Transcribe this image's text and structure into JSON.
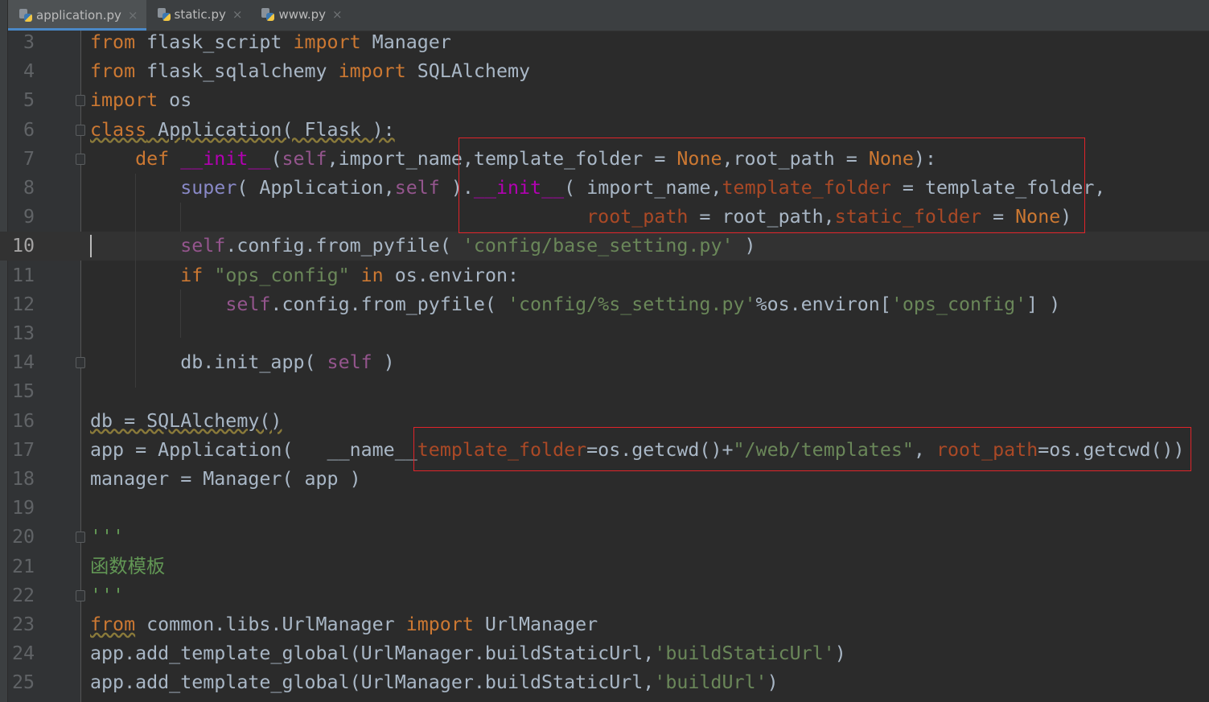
{
  "tabs": [
    {
      "label": "application.py",
      "active": true
    },
    {
      "label": "static.py"
    },
    {
      "label": "www.py"
    }
  ],
  "close_glyph": "×",
  "current_line": 10,
  "lines": [
    {
      "n": "3",
      "t": [
        [
          "from",
          "kw"
        ],
        [
          " flask_script ",
          ""
        ],
        [
          "import",
          "kw"
        ],
        [
          " Manager",
          ""
        ]
      ]
    },
    {
      "n": "4",
      "t": [
        [
          "from",
          "kw"
        ],
        [
          " flask_sqlalchemy ",
          ""
        ],
        [
          "import",
          "kw"
        ],
        [
          " SQLAlchemy",
          ""
        ]
      ]
    },
    {
      "n": "5",
      "t": [
        [
          "import",
          "kw"
        ],
        [
          " os",
          ""
        ]
      ]
    },
    {
      "n": "6",
      "t": [
        [
          "class",
          "kw wavy"
        ],
        [
          " Application( Flask ):",
          "wavy"
        ]
      ]
    },
    {
      "n": "7",
      "t": [
        [
          "    ",
          ""
        ],
        [
          "def",
          "kw"
        ],
        [
          " ",
          ""
        ],
        [
          "__init__",
          "fn"
        ],
        [
          "(",
          ""
        ],
        [
          "self",
          "self"
        ],
        [
          ",import_name,template_folder = ",
          ""
        ],
        [
          "None",
          "kw"
        ],
        [
          ",root_path = ",
          ""
        ],
        [
          "None",
          "kw"
        ],
        [
          "):",
          ""
        ]
      ]
    },
    {
      "n": "8",
      "t": [
        [
          "        ",
          ""
        ],
        [
          "super",
          "builtin"
        ],
        [
          "( Application,",
          ""
        ],
        [
          "self",
          "self"
        ],
        [
          " ).",
          ""
        ],
        [
          "__init__",
          "fn"
        ],
        [
          "( import_name,",
          ""
        ],
        [
          "template_folder",
          "param"
        ],
        [
          " = template_folder,",
          ""
        ]
      ]
    },
    {
      "n": "9",
      "t": [
        [
          "                                            ",
          ""
        ],
        [
          "root_path",
          "param"
        ],
        [
          " = root_path,",
          ""
        ],
        [
          "static_folder",
          "param"
        ],
        [
          " = ",
          ""
        ],
        [
          "None",
          "kw"
        ],
        [
          ")",
          ""
        ]
      ]
    },
    {
      "n": "10",
      "t": [
        [
          "        ",
          ""
        ],
        [
          "self",
          "self"
        ],
        [
          ".config.from_pyfile( ",
          ""
        ],
        [
          "'config/base_setting.py'",
          "str"
        ],
        [
          " )",
          ""
        ]
      ]
    },
    {
      "n": "11",
      "t": [
        [
          "        ",
          ""
        ],
        [
          "if",
          "kw"
        ],
        [
          " ",
          ""
        ],
        [
          "\"ops_config\"",
          "str"
        ],
        [
          " ",
          ""
        ],
        [
          "in",
          "kw"
        ],
        [
          " os.environ:",
          ""
        ]
      ]
    },
    {
      "n": "12",
      "t": [
        [
          "            ",
          ""
        ],
        [
          "self",
          "self"
        ],
        [
          ".config.from_pyfile( ",
          ""
        ],
        [
          "'config/%s_setting.py'",
          "str"
        ],
        [
          "%os.environ[",
          ""
        ],
        [
          "'ops_config'",
          "str"
        ],
        [
          "] )",
          ""
        ]
      ]
    },
    {
      "n": "13",
      "t": []
    },
    {
      "n": "14",
      "t": [
        [
          "        db.init_app( ",
          ""
        ],
        [
          "self",
          "self"
        ],
        [
          " )",
          ""
        ]
      ]
    },
    {
      "n": "15",
      "t": []
    },
    {
      "n": "16",
      "t": [
        [
          "db = SQLAlchemy()",
          "wavy"
        ]
      ]
    },
    {
      "n": "17",
      "t": [
        [
          "app = Application(   __name__",
          ""
        ],
        [
          "template_folder",
          "param"
        ],
        [
          "=os.getcwd()+",
          ""
        ],
        [
          "\"/web/templates\"",
          "str"
        ],
        [
          ", ",
          ""
        ],
        [
          "root_path",
          "param"
        ],
        [
          "=os.getcwd())",
          ""
        ]
      ]
    },
    {
      "n": "18",
      "t": [
        [
          "manager = Manager( app )",
          ""
        ]
      ]
    },
    {
      "n": "19",
      "t": []
    },
    {
      "n": "20",
      "t": [
        [
          "'''",
          "doc"
        ]
      ]
    },
    {
      "n": "21",
      "t": [
        [
          "函数模板",
          "doc"
        ]
      ]
    },
    {
      "n": "22",
      "t": [
        [
          "'''",
          "doc"
        ]
      ]
    },
    {
      "n": "23",
      "t": [
        [
          "from",
          "kw wavy"
        ],
        [
          " common.libs.UrlManager ",
          ""
        ],
        [
          "import",
          "kw"
        ],
        [
          " UrlManager",
          ""
        ]
      ]
    },
    {
      "n": "24",
      "t": [
        [
          "app.add_template_global(UrlManager.buildStaticUrl,",
          ""
        ],
        [
          "'buildStaticUrl'",
          "str"
        ],
        [
          ")",
          ""
        ]
      ]
    },
    {
      "n": "25",
      "t": [
        [
          "app.add_template_global(UrlManager.buildStaticUrl,",
          ""
        ],
        [
          "'buildUrl'",
          "str"
        ],
        [
          ")",
          ""
        ]
      ]
    }
  ]
}
